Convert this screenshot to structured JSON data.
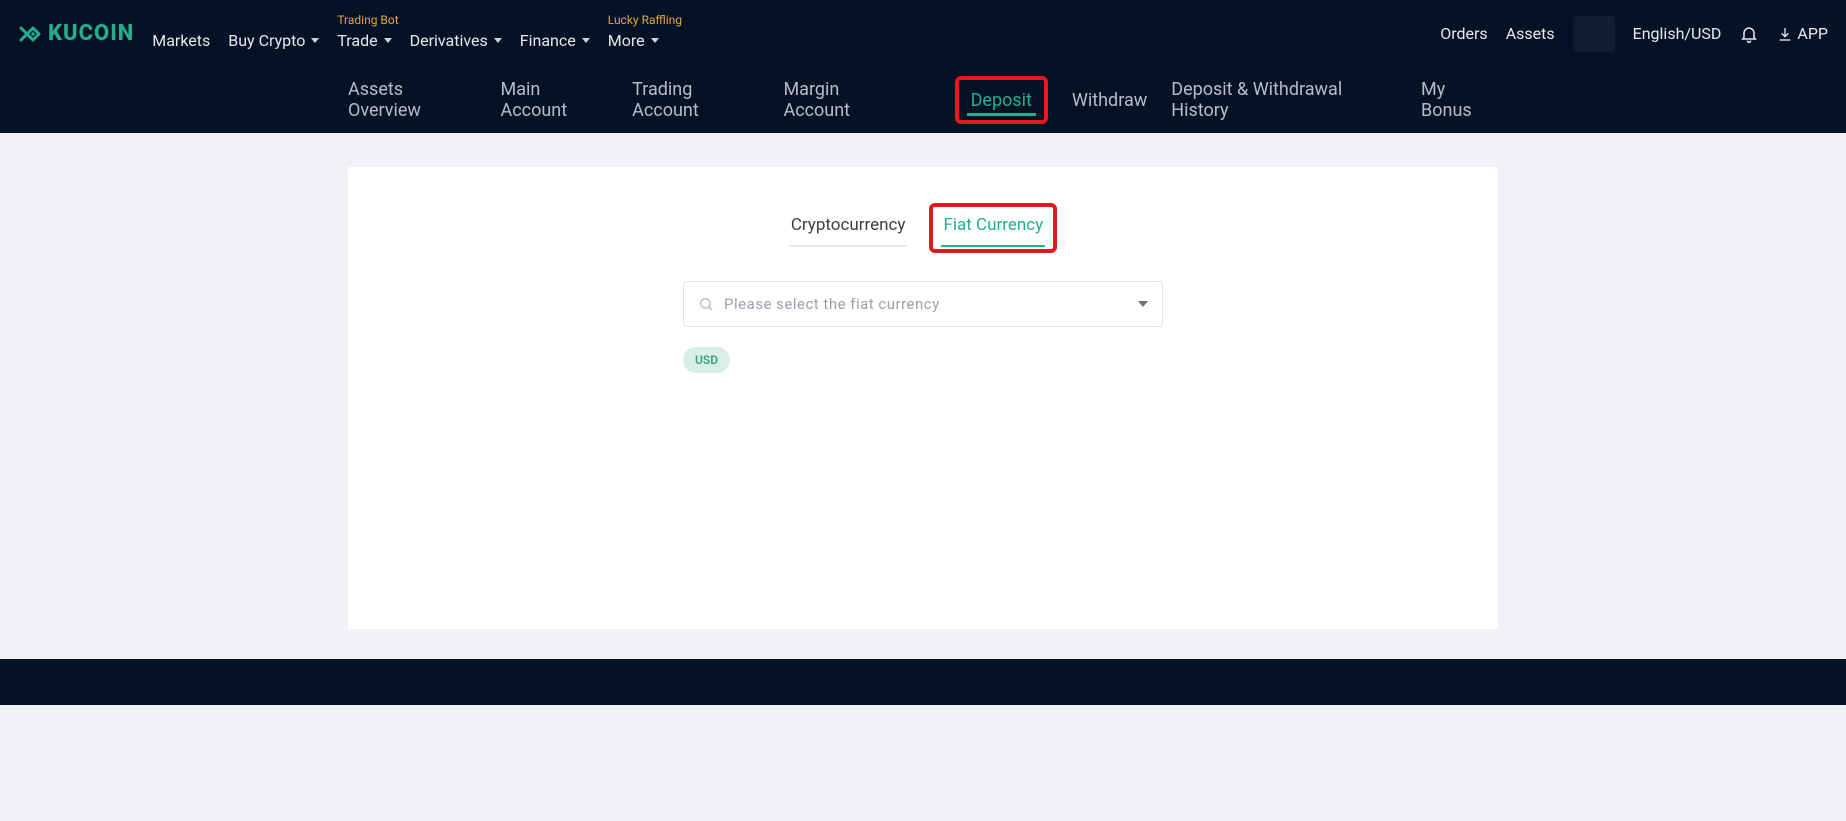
{
  "brand": {
    "name": "KUCOIN"
  },
  "topnav": {
    "items": [
      {
        "label": "Markets",
        "hasCaret": false
      },
      {
        "label": "Buy Crypto",
        "hasCaret": true
      },
      {
        "label": "Trade",
        "hasCaret": true,
        "badge": "Trading Bot"
      },
      {
        "label": "Derivatives",
        "hasCaret": true
      },
      {
        "label": "Finance",
        "hasCaret": true
      },
      {
        "label": "More",
        "hasCaret": true,
        "badge": "Lucky Raffling"
      }
    ],
    "right": {
      "orders": "Orders",
      "assets": "Assets",
      "locale": "English/USD",
      "app": "APP"
    }
  },
  "subnav": {
    "left": [
      "Assets Overview",
      "Main Account",
      "Trading Account",
      "Margin Account"
    ],
    "right": [
      {
        "label": "Deposit",
        "active": true,
        "highlighted": true
      },
      {
        "label": "Withdraw"
      },
      {
        "label": "Deposit & Withdrawal History"
      },
      {
        "label": "My Bonus"
      }
    ]
  },
  "deposit": {
    "tabs": {
      "crypto": "Cryptocurrency",
      "fiat": "Fiat Currency",
      "active": "fiat"
    },
    "select_placeholder": "Please select the fiat currency",
    "chips": [
      "USD"
    ]
  }
}
